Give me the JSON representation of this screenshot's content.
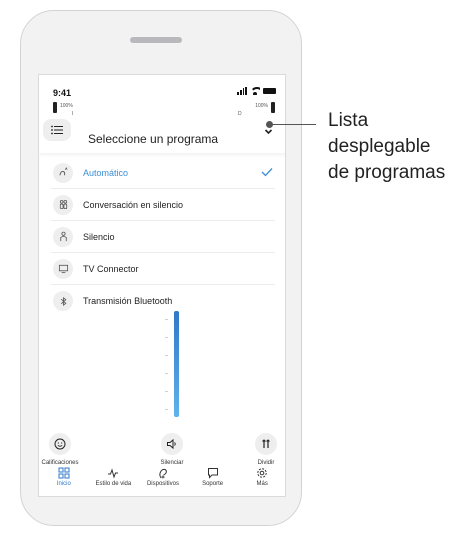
{
  "status": {
    "time": "9:41",
    "left_aid_battery": "100%",
    "right_aid_battery": "100%",
    "left_side": "I",
    "right_side": "D"
  },
  "dropdown": {
    "title": "Seleccione un programa",
    "items": [
      {
        "label": "Automático",
        "icon": "auto-program-icon",
        "selected": true
      },
      {
        "label": "Conversación en silencio",
        "icon": "conversation-icon",
        "selected": false
      },
      {
        "label": "Silencio",
        "icon": "quiet-icon",
        "selected": false
      },
      {
        "label": "TV Connector",
        "icon": "tv-icon",
        "selected": false
      },
      {
        "label": "Transmisión Bluetooth",
        "icon": "bluetooth-icon",
        "selected": false
      }
    ]
  },
  "volume": {
    "level": 1.0
  },
  "quick_actions": [
    {
      "label": "Calificaciones",
      "icon": "smiley-icon"
    },
    {
      "label": "Silenciar",
      "icon": "mute-speaker-icon"
    },
    {
      "label": "Dividir",
      "icon": "split-icon"
    }
  ],
  "tabs": [
    {
      "label": "Inicio",
      "icon": "home-grid-icon",
      "active": true
    },
    {
      "label": "Estilo de vida",
      "icon": "activity-icon",
      "active": false
    },
    {
      "label": "Dispositivos",
      "icon": "hearing-aid-icon",
      "active": false
    },
    {
      "label": "Soporte",
      "icon": "chat-bubble-icon",
      "active": false
    },
    {
      "label": "Más",
      "icon": "gear-icon",
      "active": false
    }
  ],
  "callout": {
    "lines": [
      "Lista",
      "desplegable",
      "de programas"
    ]
  },
  "colors": {
    "accent": "#3b8fd6",
    "slider": "#2f78c8"
  }
}
